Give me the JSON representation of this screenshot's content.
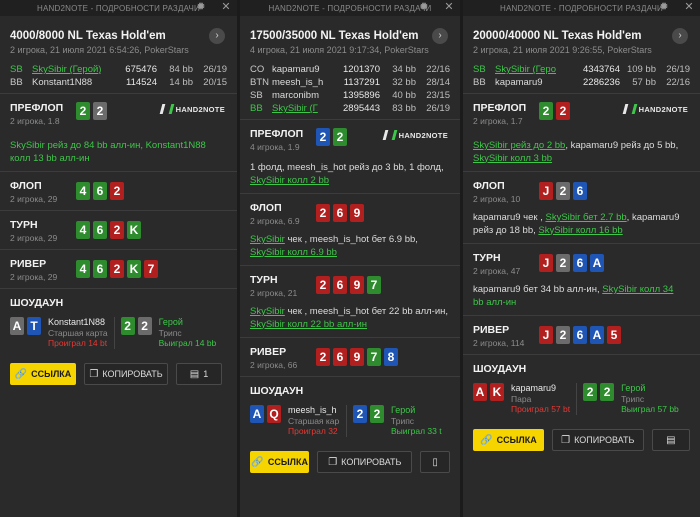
{
  "app_title": "HAND2NOTE - ПОДРОБНОСТИ РАЗДАЧИ",
  "logo_text": "HAND2NOTE",
  "labels": {
    "preflop": "ПРЕФЛОП",
    "flop": "ФЛОП",
    "turn": "ТУРН",
    "river": "РИВЕР",
    "showdown": "ШОУДАУН",
    "link": "ССЫЛКА",
    "copy": "КОПИРОВАТЬ"
  },
  "hand1": {
    "game": "4000/8000 NL Texas Hold'em",
    "sub": "2 игрока, 21 июля 2021 6:54:26, PokerStars",
    "players": [
      {
        "pos": "SB",
        "name": "SkySibir (Герой)",
        "stack": "675476",
        "bb": "84 bb",
        "hist": "26/19"
      },
      {
        "pos": "BB",
        "name": "Konstant1N88",
        "stack": "114524",
        "bb": "14 bb",
        "hist": "20/15"
      }
    ],
    "preflop_count": "2 игрока, 1.8",
    "action_pre": [
      "SkySibir рейз до 84 bb алл-ин, Konstant1N88",
      "колл 13 bb алл-ин"
    ],
    "flop_count": "2 игрока, 29",
    "turn_count": "2 игрока, 29",
    "river_count": "2 игрока, 29",
    "sd_p1": {
      "name": "Konstant1N88",
      "hand": "Старшая карта",
      "result": "Проиграл 14 bt"
    },
    "sd_p2": {
      "name": "Герой",
      "hand": "Трипс",
      "result": "Выиграл 14 bb"
    },
    "count_btn": "1"
  },
  "hand2": {
    "game": "17500/35000 NL Texas Hold'em",
    "sub": "4 игрока, 21 июля 2021 9:17:34, PokerStars",
    "players": [
      {
        "pos": "CO",
        "name": "kapamaru9",
        "stack": "1201370",
        "bb": "34 bb",
        "hist": "22/16"
      },
      {
        "pos": "BTN",
        "name": "meesh_is_h",
        "stack": "1137291",
        "bb": "32 bb",
        "hist": "28/14"
      },
      {
        "pos": "SB",
        "name": "marconibm",
        "stack": "1395896",
        "bb": "40 bb",
        "hist": "23/15"
      },
      {
        "pos": "BB",
        "name": "SkySibir (Г",
        "stack": "2895443",
        "bb": "83 bb",
        "hist": "26/19"
      }
    ],
    "preflop_count": "4 игрока, 1.9",
    "action_pre_1": "1 фолд, meesh_is_hot рейз до 3 bb, 1 фолд,",
    "action_pre_2": "SkySibir колл 2 bb",
    "flop_count": "2 игрока, 6.9",
    "action_flop_1a": "SkySibir",
    "action_flop_1b": " чек , meesh_is_hot бет 6.9 bb,",
    "action_flop_2": "SkySibir колл 6.9 bb",
    "turn_count": "2 игрока, 21",
    "action_turn_1a": "SkySibir",
    "action_turn_1b": " чек , meesh_is_hot бет 22 bb алл-ин,",
    "action_turn_2": "SkySibir колл 22 bb алл-ин",
    "river_count": "2 игрока, 66",
    "sd_p1": {
      "name": "meesh_is_h",
      "hand": "Старшая кар",
      "result": "Проиграл 32 I"
    },
    "sd_p2": {
      "name": "Герой",
      "hand": "Трипс",
      "result": "Выиграл 33 t"
    }
  },
  "hand3": {
    "game": "20000/40000 NL Texas Hold'em",
    "sub": "2 игрока, 21 июля 2021 9:26:55, PokerStars",
    "players": [
      {
        "pos": "SB",
        "name": "SkySibir (Геро",
        "stack": "4343764",
        "bb": "109 bb",
        "hist": "26/19"
      },
      {
        "pos": "BB",
        "name": "kapamaru9",
        "stack": "2286236",
        "bb": "57 bb",
        "hist": "22/16"
      }
    ],
    "preflop_count": "2 игрока, 1.7",
    "action_pre_1a": "SkySibir рейз до 2 bb",
    "action_pre_1b": ", kapamaru9 рейз до 5 bb,",
    "action_pre_2": "SkySibir колл 3 bb",
    "flop_count": "2 игрока, 10",
    "action_flop_1a": "kapamaru9 чек , ",
    "action_flop_1b": "SkySibir бет 2.7 bb",
    "action_flop_1c": ", kapamaru9",
    "action_flop_2a": "рейз до 18 bb, ",
    "action_flop_2b": "SkySibir колл 16 bb",
    "turn_count": "2 игрока, 47",
    "action_turn_1a": "kapamaru9 бет 34 bb алл-ин, ",
    "action_turn_1b": "SkySibir колл 34",
    "action_turn_2": "bb алл-ин",
    "river_count": "2 игрока, 114",
    "sd_p1": {
      "name": "kapamaru9",
      "hand": "Пара",
      "result": "Проиграл 57 bt"
    },
    "sd_p2": {
      "name": "Герой",
      "hand": "Трипс",
      "result": "Выиграл 57 bb"
    }
  },
  "colors": {
    "hero_green": "#3ec64a",
    "link_yellow": "#f5d400",
    "lost_red": "#e53935"
  }
}
